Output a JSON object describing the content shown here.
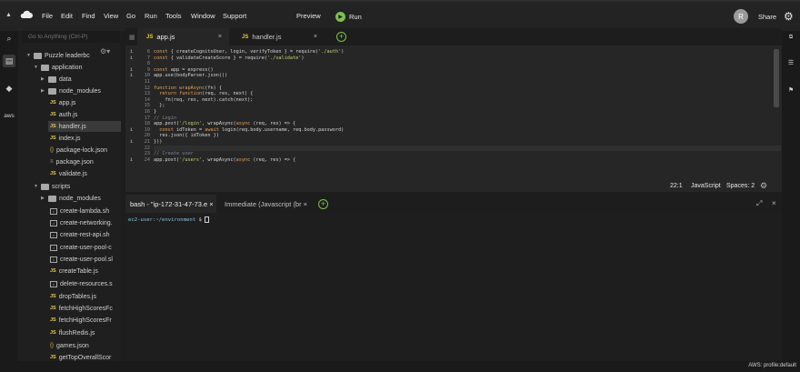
{
  "menubar": {
    "items": [
      "File",
      "Edit",
      "Find",
      "View",
      "Go",
      "Run",
      "Tools",
      "Window",
      "Support"
    ],
    "preview": "Preview",
    "run": "Run",
    "avatar_letter": "R",
    "share": "Share"
  },
  "sidebar": {
    "goto_placeholder": "Go to Anything (Ctrl-P)",
    "tree": [
      {
        "label": "Puzzle leaderbc",
        "kind": "folder-open"
      },
      {
        "label": "application",
        "kind": "folder-open"
      },
      {
        "label": "data",
        "kind": "folder"
      },
      {
        "label": "node_modules",
        "kind": "folder"
      },
      {
        "label": "app.js",
        "kind": "js"
      },
      {
        "label": "auth.js",
        "kind": "js"
      },
      {
        "label": "handler.js",
        "kind": "js"
      },
      {
        "label": "index.js",
        "kind": "js"
      },
      {
        "label": "package-lock.json",
        "kind": "json"
      },
      {
        "label": "package.json",
        "kind": "eq"
      },
      {
        "label": "validate.js",
        "kind": "js"
      },
      {
        "label": "scripts",
        "kind": "folder-open"
      },
      {
        "label": "node_modules",
        "kind": "folder"
      },
      {
        "label": "create-lambda.sh",
        "kind": "sh"
      },
      {
        "label": "create-networking.",
        "kind": "sh"
      },
      {
        "label": "create-rest-api.sh",
        "kind": "sh"
      },
      {
        "label": "create-user-pool-c",
        "kind": "sh"
      },
      {
        "label": "create-user-pool.sl",
        "kind": "sh"
      },
      {
        "label": "createTable.js",
        "kind": "js"
      },
      {
        "label": "delete-resources.s",
        "kind": "sh"
      },
      {
        "label": "dropTables.js",
        "kind": "js"
      },
      {
        "label": "fetchHighScoresFс",
        "kind": "js"
      },
      {
        "label": "fetchHighScoresFr",
        "kind": "js"
      },
      {
        "label": "flushRedis.js",
        "kind": "js"
      },
      {
        "label": "games.json",
        "kind": "json"
      },
      {
        "label": "getTopOverallScor",
        "kind": "js"
      }
    ]
  },
  "tabs": [
    {
      "label": "app.js",
      "badge": "JS"
    },
    {
      "label": "handler.js",
      "badge": "JS"
    }
  ],
  "editor": {
    "line_numbers": [
      "6",
      "7",
      "8",
      "9",
      "10",
      "11",
      "12",
      "13",
      "14",
      "15",
      "16",
      "17",
      "18",
      "19",
      "20",
      "21",
      "22",
      "23",
      "24"
    ],
    "status": {
      "position": "22:1",
      "language": "JavaScript",
      "spaces": "Spaces: 2"
    }
  },
  "terminal": {
    "tab_bash": "bash - \"ip-172-31-47-73.e",
    "tab_immediate": "Immediate (Javascript (br",
    "prompt_user": "ec2-user:~/environment",
    "prompt_symbol": "$"
  },
  "footer": {
    "profile": "AWS: profile:default"
  }
}
